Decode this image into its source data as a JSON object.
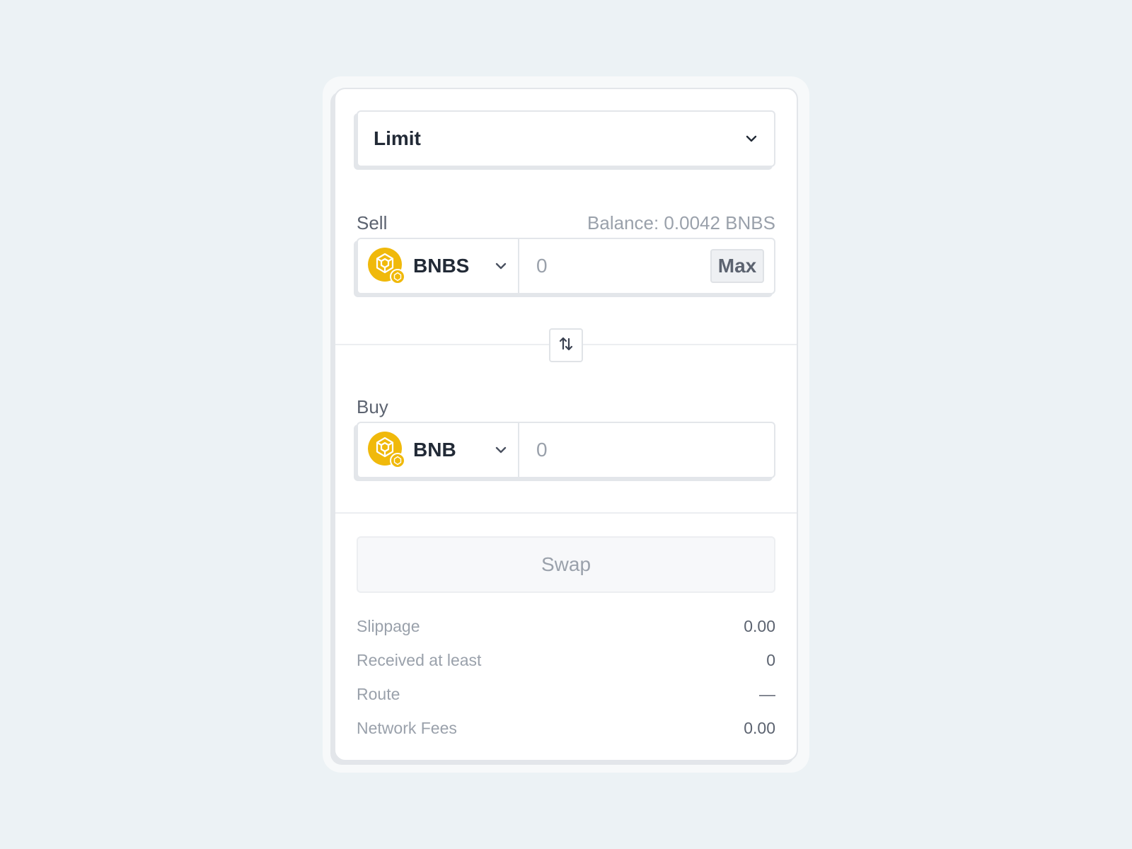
{
  "order_type": {
    "selected": "Limit",
    "icon": "chevron-down-icon"
  },
  "sell": {
    "label": "Sell",
    "balance": "Balance: 0.0042 BNBS",
    "token": "BNBS",
    "amount_placeholder": "0",
    "max_label": "Max"
  },
  "buy": {
    "label": "Buy",
    "token": "BNB",
    "amount_placeholder": "0"
  },
  "swap_button": "Swap",
  "details": [
    {
      "label": "Slippage",
      "value": "0.00"
    },
    {
      "label": "Received at least",
      "value": "0"
    },
    {
      "label": "Route",
      "value": "—"
    },
    {
      "label": "Network Fees",
      "value": "0.00"
    }
  ],
  "colors": {
    "token_yellow": "#F0B90B",
    "background": "#ECF2F5",
    "card": "#FFFFFF"
  }
}
